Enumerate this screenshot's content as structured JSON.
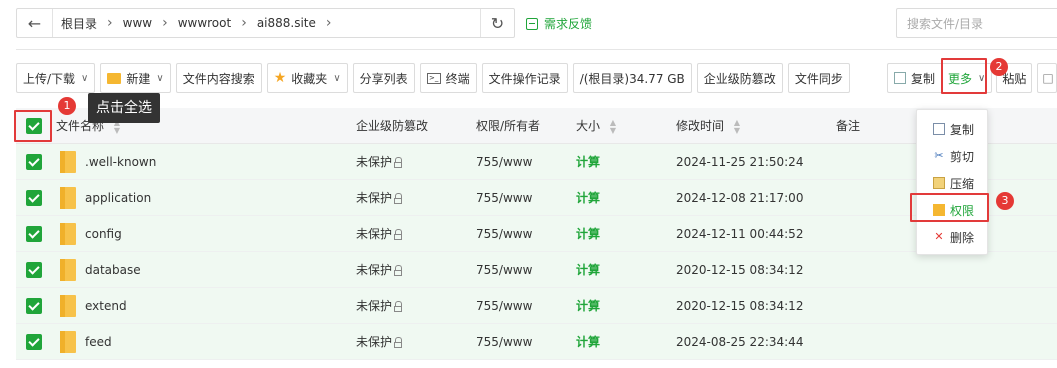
{
  "path_bar": {
    "crumbs": [
      "根目录",
      "www",
      "wwwroot",
      "ai888.site"
    ],
    "back_icon": "arrow-left-icon",
    "refresh_icon": "refresh-icon"
  },
  "feedback_label": "需求反馈",
  "search": {
    "placeholder": "搜索文件/目录"
  },
  "toolbar": {
    "upload_download": "上传/下载",
    "new": "新建",
    "content_search": "文件内容搜索",
    "favorites": "收藏夹",
    "share_list": "分享列表",
    "terminal": "终端",
    "file_log": "文件操作记录",
    "disk_usage": "/(根目录)34.77 GB",
    "tamper_protect": "企业级防篡改",
    "file_sync": "文件同步",
    "copy": "复制",
    "more": "更多",
    "paste": "粘贴"
  },
  "annotations": {
    "tooltip": "点击全选",
    "badge1": "1",
    "badge2": "2",
    "badge3": "3"
  },
  "table": {
    "headers": {
      "name": "文件名称",
      "tamper": "企业级防篡改",
      "perm": "权限/所有者",
      "size": "大小",
      "mtime": "修改时间",
      "remark": "备注"
    },
    "rows": [
      {
        "name": ".well-known",
        "tamper": "未保护",
        "perm": "755/www",
        "size": "计算",
        "mtime": "2024-11-25 21:50:24"
      },
      {
        "name": "application",
        "tamper": "未保护",
        "perm": "755/www",
        "size": "计算",
        "mtime": "2024-12-08 21:17:00"
      },
      {
        "name": "config",
        "tamper": "未保护",
        "perm": "755/www",
        "size": "计算",
        "mtime": "2024-12-11 00:44:52"
      },
      {
        "name": "database",
        "tamper": "未保护",
        "perm": "755/www",
        "size": "计算",
        "mtime": "2020-12-15 08:34:12"
      },
      {
        "name": "extend",
        "tamper": "未保护",
        "perm": "755/www",
        "size": "计算",
        "mtime": "2020-12-15 08:34:12"
      },
      {
        "name": "feed",
        "tamper": "未保护",
        "perm": "755/www",
        "size": "计算",
        "mtime": "2024-08-25 22:34:44"
      }
    ]
  },
  "more_menu": {
    "items": [
      "复制",
      "剪切",
      "压缩",
      "权限",
      "删除"
    ]
  },
  "colors": {
    "accent_green": "#20a53a",
    "highlight_red": "#e23a3a",
    "row_selected_bg": "#f0f9f2"
  }
}
